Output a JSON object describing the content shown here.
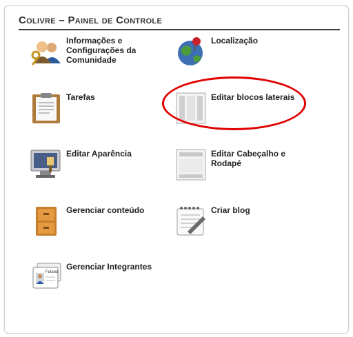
{
  "panel": {
    "title": "Colivre – Painel de Controle"
  },
  "items": [
    {
      "id": "community",
      "label": "Informações e Configurações da Comunidade",
      "icon": "people-key-icon"
    },
    {
      "id": "location",
      "label": "Localização",
      "icon": "globe-pin-icon"
    },
    {
      "id": "tasks",
      "label": "Tarefas",
      "icon": "clipboard-icon"
    },
    {
      "id": "side-blocks",
      "label": "Editar blocos laterais",
      "icon": "side-blocks-icon"
    },
    {
      "id": "appearance",
      "label": "Editar Aparência",
      "icon": "monitor-paint-icon"
    },
    {
      "id": "header-footer",
      "label": "Editar Cabeçalho e Rodapé",
      "icon": "header-footer-icon"
    },
    {
      "id": "content",
      "label": "Gerenciar conteúdo",
      "icon": "drawer-cabinet-icon"
    },
    {
      "id": "blog",
      "label": "Criar blog",
      "icon": "notepad-pen-icon"
    },
    {
      "id": "members",
      "label": "Gerenciar Integrantes",
      "icon": "member-cards-icon"
    }
  ],
  "member_card_name": "Fulana",
  "accent_highlight": "#e10000"
}
